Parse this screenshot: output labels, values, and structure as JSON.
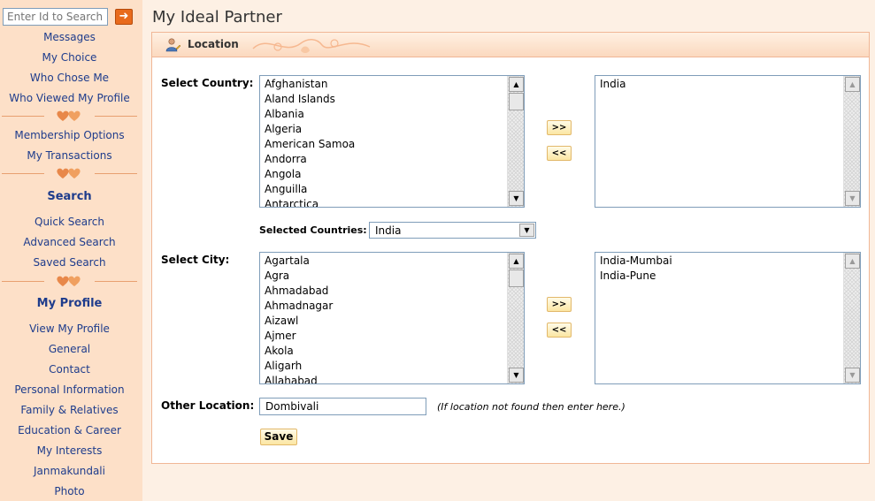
{
  "sidebar": {
    "search": {
      "placeholder": "Enter Id to Search",
      "go_icon": "arrow-right-icon"
    },
    "links_1": [
      "Messages",
      "My Choice",
      "Who Chose Me",
      "Who Viewed My Profile"
    ],
    "links_2": [
      "Membership Options",
      "My Transactions"
    ],
    "search_heading": "Search",
    "links_3": [
      "Quick Search",
      "Advanced Search",
      "Saved Search"
    ],
    "profile_heading": "My Profile",
    "links_4": [
      "View My Profile",
      "General",
      "Contact",
      "Personal Information",
      "Family & Relatives",
      "Education & Career",
      "My Interests",
      "Janmakundali",
      "Photo"
    ],
    "divider_icon": "hearts-icon"
  },
  "main": {
    "title": "My Ideal Partner",
    "panel_title": "Location",
    "panel_icon": "user-edit-icon",
    "country": {
      "label": "Select Country:",
      "available": [
        "Afghanistan",
        "Aland Islands",
        "Albania",
        "Algeria",
        "American Samoa",
        "Andorra",
        "Angola",
        "Anguilla",
        "Antarctica"
      ],
      "selected": [
        "India"
      ],
      "add_label": ">>",
      "remove_label": "<<"
    },
    "selected_countries": {
      "label": "Selected Countries:",
      "value": "India"
    },
    "city": {
      "label": "Select City:",
      "available": [
        "Agartala",
        "Agra",
        "Ahmadabad",
        "Ahmadnagar",
        "Aizawl",
        "Ajmer",
        "Akola",
        "Aligarh",
        "Allahabad"
      ],
      "selected": [
        "India-Mumbai",
        "India-Pune"
      ],
      "add_label": ">>",
      "remove_label": "<<"
    },
    "other_location": {
      "label": "Other Location:",
      "value": "Dombivali",
      "hint": "(If location not found then enter here.)"
    },
    "save_label": "Save"
  },
  "colors": {
    "link": "#1e3c8c",
    "sidebar_bg": "#fde0c8",
    "page_bg": "#fdf0e4",
    "panel_border": "#f0b796",
    "button_bg": "#fbe6a3"
  }
}
